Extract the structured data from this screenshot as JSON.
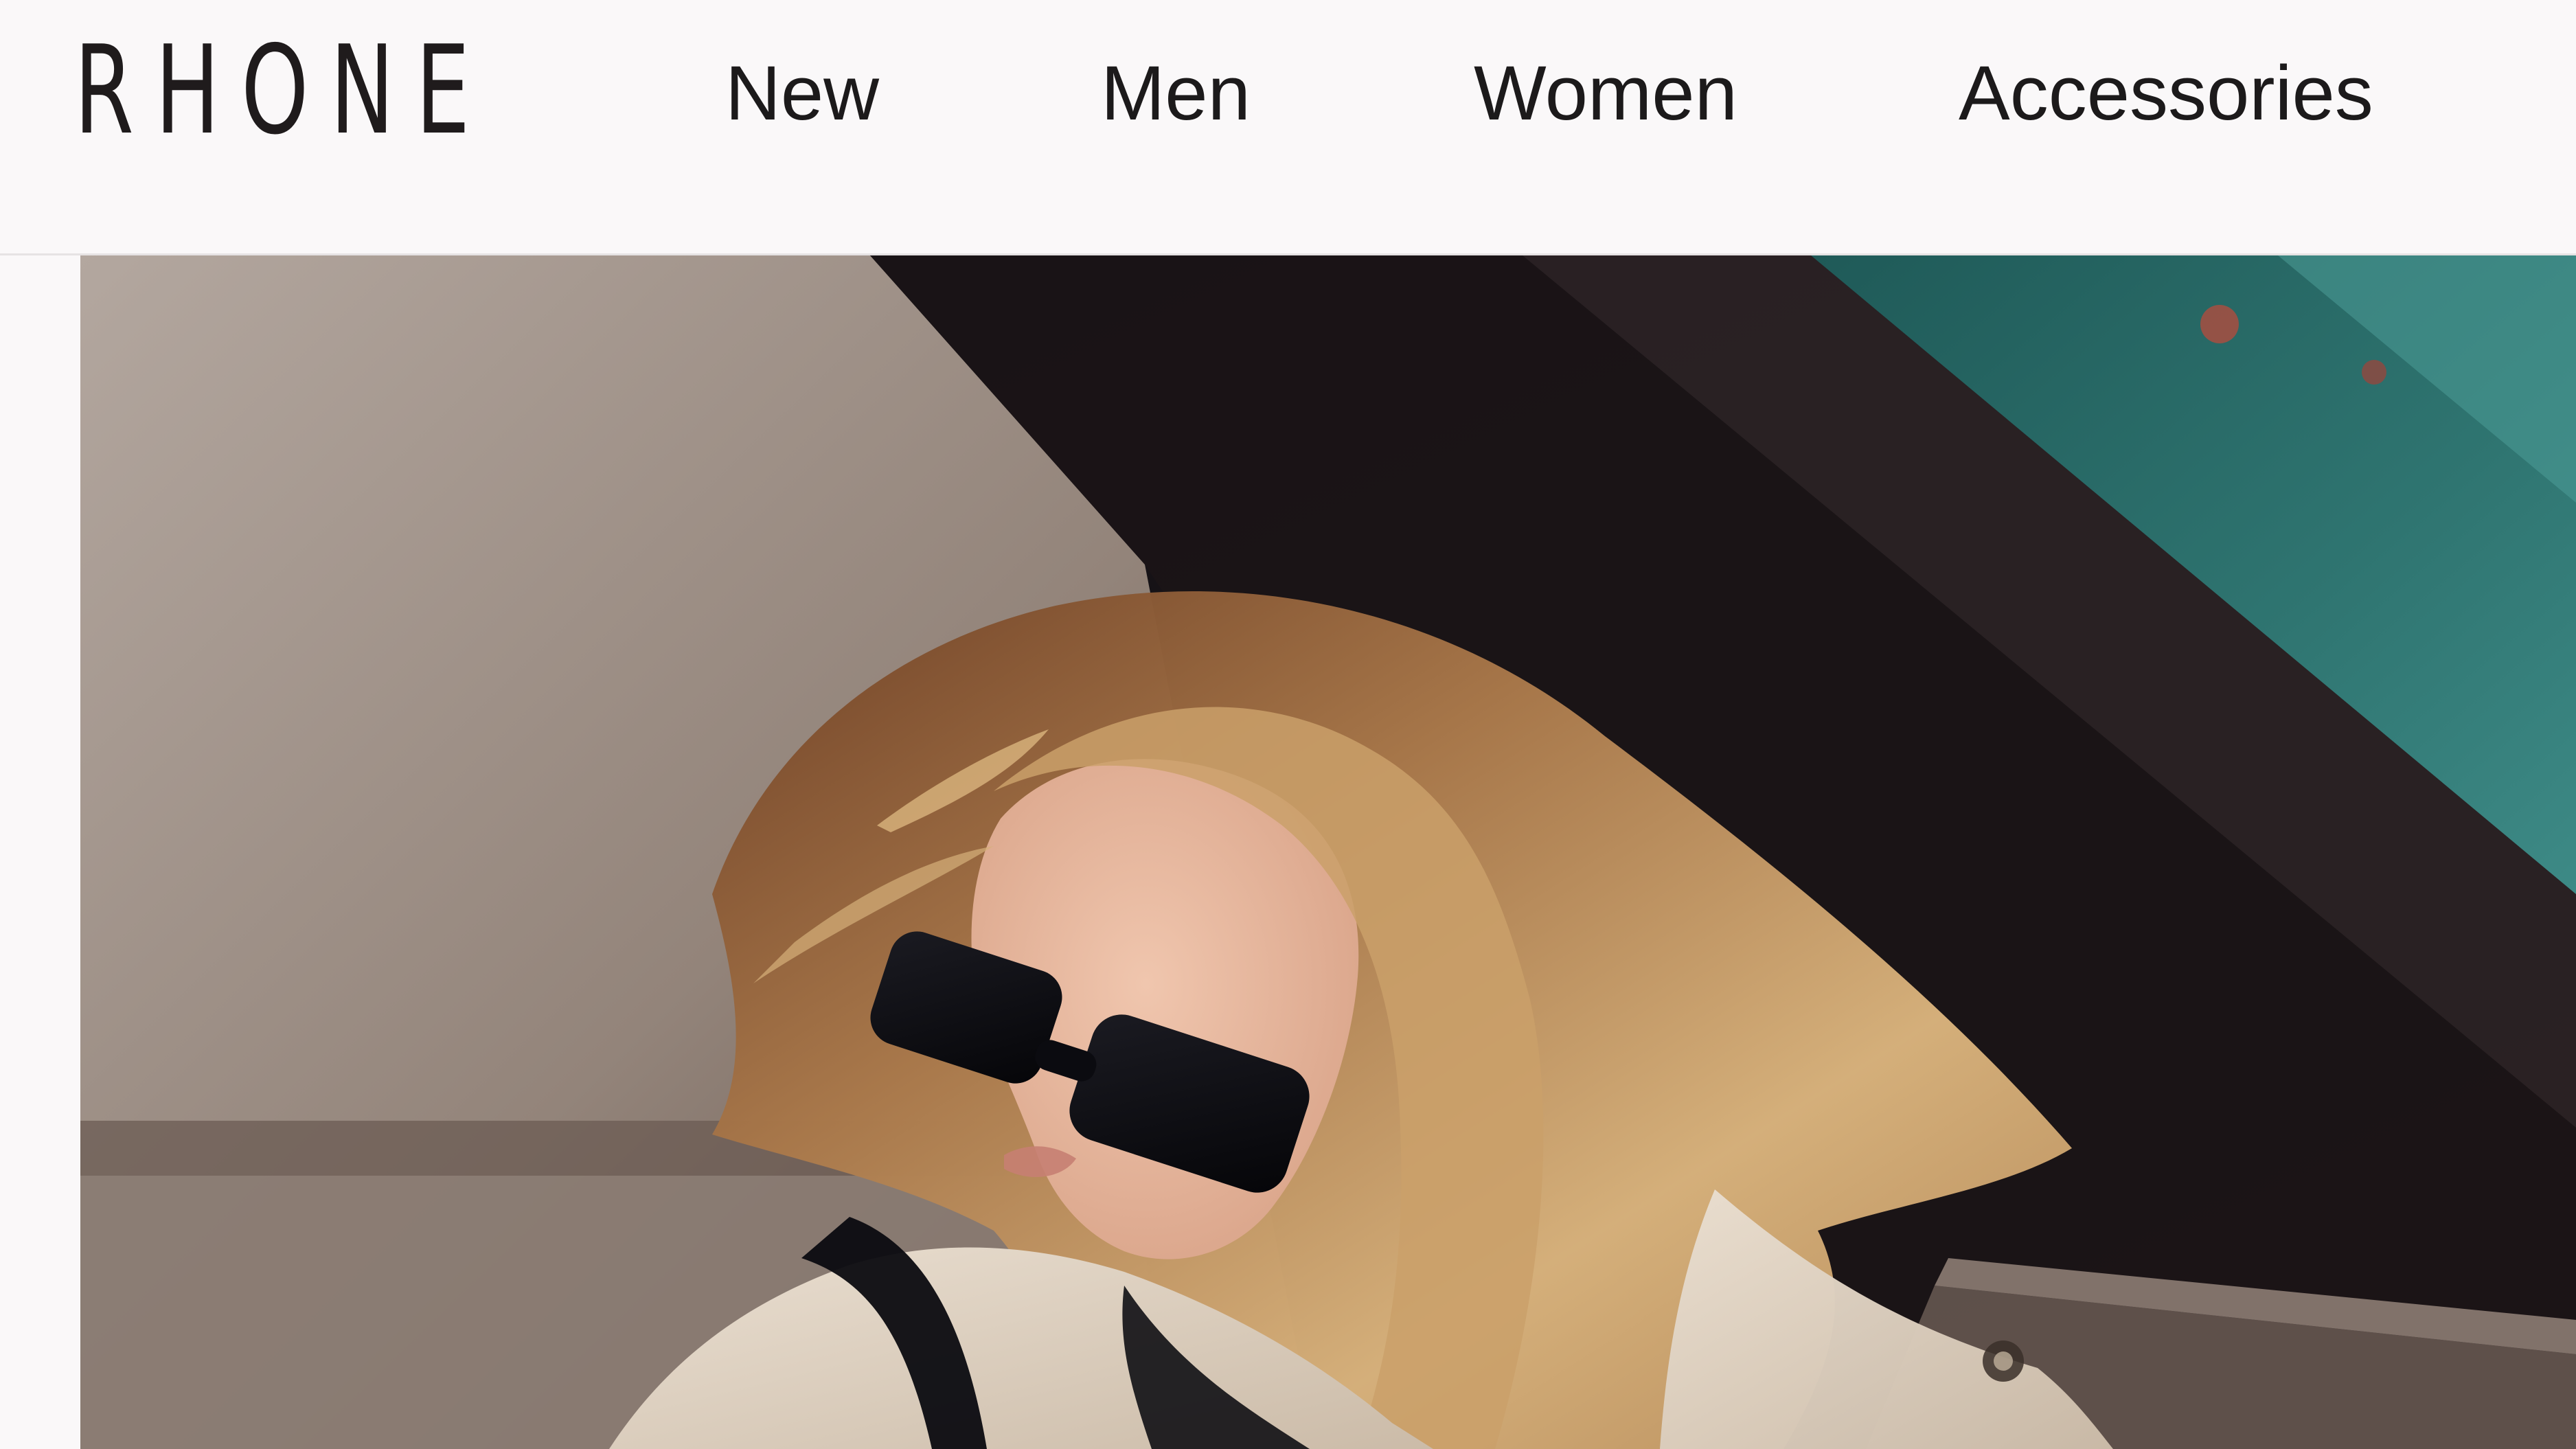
{
  "brand": {
    "logo_text": "RHONE"
  },
  "nav": {
    "items": [
      {
        "label": "New"
      },
      {
        "label": "Men"
      },
      {
        "label": "Women"
      },
      {
        "label": "Accessories"
      }
    ]
  },
  "hero": {
    "colors": {
      "wall_light": "#a3968d",
      "wall_dark": "#6a5a52",
      "shadow": "#161214",
      "teal": "#2f6f6c",
      "hair_light": "#d8b078",
      "hair_dark": "#7a4a2a",
      "skin": "#e7b8a0",
      "coat": "#e4d8c8",
      "sunglasses": "#0c0c10"
    }
  }
}
